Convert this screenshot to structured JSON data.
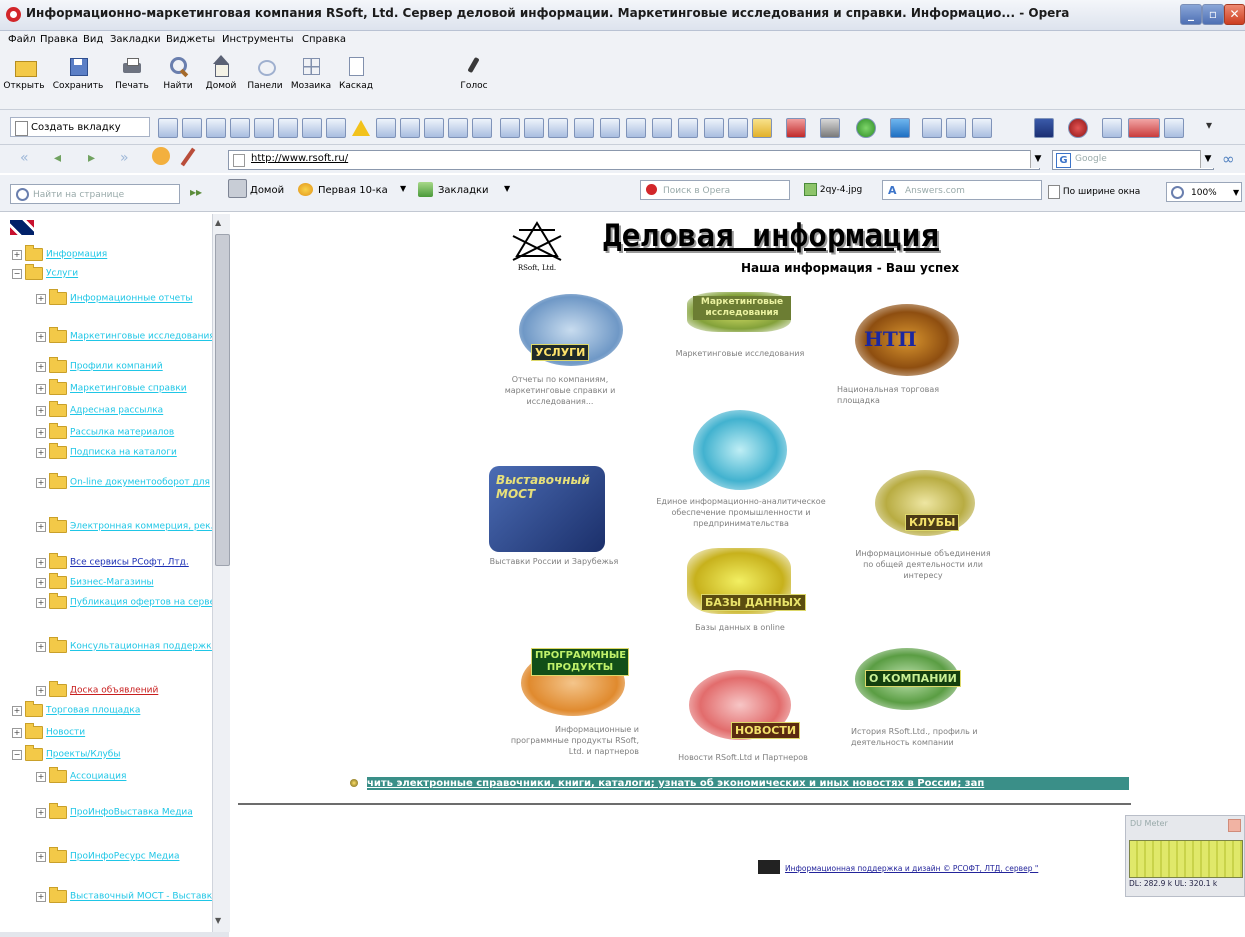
{
  "window": {
    "title": "Информационно-маркетинговая компания RSoft, Ltd. Сервер деловой информации. Маркетинговые исследования и справки. Информацио... - Opera"
  },
  "menu": [
    "Файл",
    "Правка",
    "Вид",
    "Закладки",
    "Виджеты",
    "Инструменты",
    "Справка"
  ],
  "toolbar": [
    {
      "label": "Открыть",
      "icon": "folder-open-icon"
    },
    {
      "label": "Сохранить",
      "icon": "save-icon"
    },
    {
      "label": "Печать",
      "icon": "print-icon"
    },
    {
      "label": "Найти",
      "icon": "magnifier-icon"
    },
    {
      "label": "Домой",
      "icon": "home-icon"
    },
    {
      "label": "Панели",
      "icon": "panels-icon"
    },
    {
      "label": "Мозаика",
      "icon": "tile-icon"
    },
    {
      "label": "Каскад",
      "icon": "cascade-icon"
    },
    {
      "label": "Голос",
      "icon": "voice-icon"
    }
  ],
  "tabs": {
    "new_tab": "Создать вкладку"
  },
  "address": {
    "url": "http://www.rsoft.ru/",
    "search_engine": "Google"
  },
  "bookmarks": {
    "find_placeholder": "Найти на странице",
    "home": "Домой",
    "first10": "Первая 10-ка",
    "bookmarks": "Закладки",
    "opera_search": "Поиск в Opera",
    "image": "2qy-4.jpg",
    "answers": "Answers.com",
    "fit_width": "По ширине окна",
    "zoom": "100%"
  },
  "sidebar": {
    "items": [
      {
        "label": "Информация",
        "style": "link",
        "level": 0,
        "expanded": false
      },
      {
        "label": "Услуги",
        "style": "link",
        "level": 0,
        "expanded": true
      },
      {
        "label": "Информационные отчеты",
        "style": "link",
        "level": 1
      },
      {
        "label": "Маркетинговые исследования",
        "style": "link",
        "level": 1
      },
      {
        "label": "Профили компаний",
        "style": "link",
        "level": 1
      },
      {
        "label": "Маркетинговые справки",
        "style": "link",
        "level": 1
      },
      {
        "label": "Адресная рассылка",
        "style": "link",
        "level": 1
      },
      {
        "label": "Рассылка материалов",
        "style": "link",
        "level": 1
      },
      {
        "label": "Подписка на каталоги",
        "style": "link",
        "level": 1
      },
      {
        "label": "On-line документооборот для",
        "style": "link",
        "level": 1
      },
      {
        "label": "Электронная коммерция, рекламная",
        "style": "link",
        "level": 1
      },
      {
        "label": "Все сервисы РСофт, Лтд.",
        "style": "blue",
        "level": 1
      },
      {
        "label": "Бизнес-Магазины",
        "style": "link",
        "level": 1
      },
      {
        "label": "Публикация офертов на серверах",
        "style": "link",
        "level": 1
      },
      {
        "label": "Консультационная поддержка",
        "style": "link",
        "level": 1
      },
      {
        "label": "Доска объявлений",
        "style": "red",
        "level": 1
      },
      {
        "label": "Торговая площадка",
        "style": "link",
        "level": 0,
        "expanded": false
      },
      {
        "label": "Новости",
        "style": "link",
        "level": 0,
        "expanded": false
      },
      {
        "label": "Проекты/Клубы",
        "style": "link",
        "level": 0,
        "expanded": true
      },
      {
        "label": "Ассоциация",
        "style": "link",
        "level": 1
      },
      {
        "label": "ПроИнфоВыставка Медиа",
        "style": "link",
        "level": 1
      },
      {
        "label": "ПроИнфоРесурс Медиа",
        "style": "link",
        "level": 1
      },
      {
        "label": "Выставочный МОСТ - Выставки",
        "style": "link",
        "level": 1
      }
    ]
  },
  "page": {
    "logo_text": "RSoft, Ltd.",
    "heading": "Деловая информация",
    "slogan": "Наша информация - Ваш успех",
    "tiles": [
      {
        "tag": "УСЛУГИ",
        "caption": "Отчеты по компаниям, маркетинговые справки и исследования..."
      },
      {
        "tag": "Маркетинговые исследования",
        "caption": "Маркетинговые исследования"
      },
      {
        "tag": "НТП",
        "caption": "Национальная торговая площадка"
      },
      {
        "tag": "",
        "caption": "Единое информационно-аналитическое обеспечение промышленности и предпринимательства"
      },
      {
        "tag": "Выставочный МОСТ",
        "caption": "Выставки России и Зарубежья"
      },
      {
        "tag": "КЛУБЫ",
        "caption": "Информационные объединения по общей деятельности или интересу"
      },
      {
        "tag": "БАЗЫ ДАННЫХ",
        "caption": "Базы данных в online"
      },
      {
        "tag": "ПРОГРАММНЫЕ ПРОДУКТЫ",
        "caption": "Информационные и программные продукты RSoft, Ltd. и партнеров"
      },
      {
        "tag": "НОВОСТИ",
        "caption": "Новости RSoft.Ltd и Партнеров"
      },
      {
        "tag": "О КОМПАНИИ",
        "caption": "История RSoft.Ltd., профиль и деятельность компании"
      }
    ],
    "marquee": "чить электронные справочники, книги, каталоги; узнать об экономических и иных новостях в России; зап",
    "footer": "Информационная поддержка и дизайн © РСОФТ, ЛТД, сервер \""
  },
  "du_meter": {
    "title": "DU Meter",
    "readout": "DL: 282.9 k  UL: 320.1 k"
  }
}
